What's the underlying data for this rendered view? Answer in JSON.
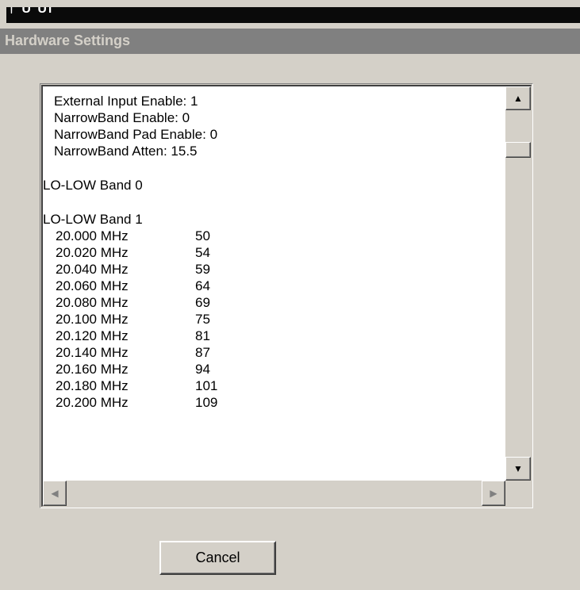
{
  "parent_window": {
    "title_fragment": "† U Ui"
  },
  "dialog": {
    "title": "Hardware Settings"
  },
  "settings_list": {
    "lines": [
      "External Input Enable: 1",
      "NarrowBand Enable: 0",
      "NarrowBand Pad Enable: 0",
      "NarrowBand Atten: 15.5"
    ],
    "band0_header": "LO-LOW Band 0",
    "band1_header": "LO-LOW Band 1",
    "band1_rows": [
      {
        "freq": "20.000 MHz",
        "value": "50"
      },
      {
        "freq": "20.020 MHz",
        "value": "54"
      },
      {
        "freq": "20.040 MHz",
        "value": "59"
      },
      {
        "freq": "20.060 MHz",
        "value": "64"
      },
      {
        "freq": "20.080 MHz",
        "value": "69"
      },
      {
        "freq": "20.100 MHz",
        "value": "75"
      },
      {
        "freq": "20.120 MHz",
        "value": "81"
      },
      {
        "freq": "20.140 MHz",
        "value": "87"
      },
      {
        "freq": "20.160 MHz",
        "value": "94"
      },
      {
        "freq": "20.180 MHz",
        "value": "101"
      },
      {
        "freq": "20.200 MHz",
        "value": "109"
      }
    ]
  },
  "scrollbars": {
    "up_glyph": "▲",
    "down_glyph": "▼",
    "left_glyph": "◀",
    "right_glyph": "▶"
  },
  "buttons": {
    "cancel_label": "Cancel"
  }
}
